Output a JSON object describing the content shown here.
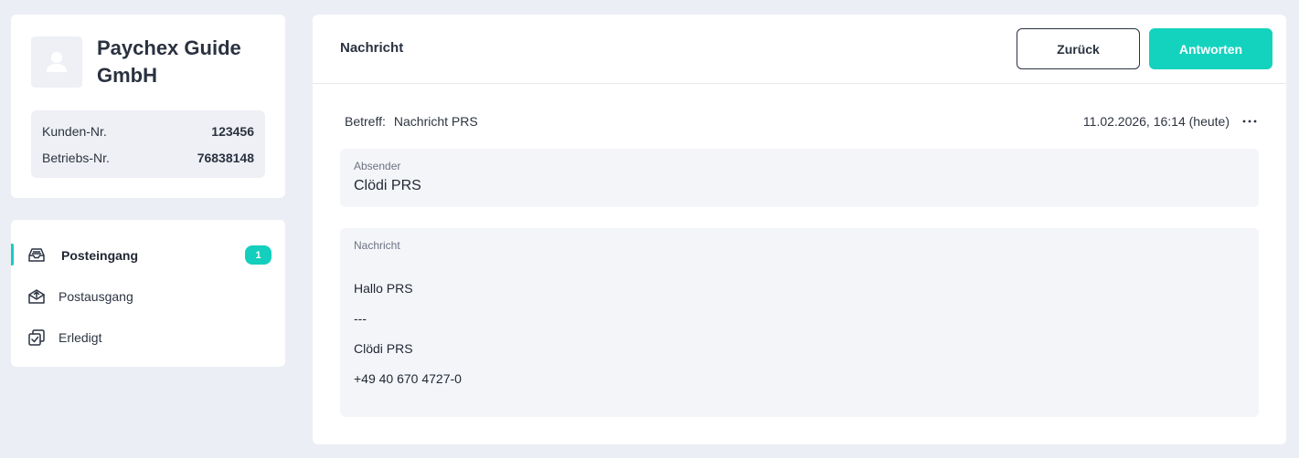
{
  "company": {
    "name": "Paychex Guide GmbH",
    "customer_no_label": "Kunden-Nr.",
    "customer_no": "123456",
    "company_no_label": "Betriebs-Nr.",
    "company_no": "76838148"
  },
  "nav": {
    "items": [
      {
        "label": "Posteingang",
        "icon": "inbox-icon",
        "active": true,
        "badge": "1"
      },
      {
        "label": "Postausgang",
        "icon": "outbox-icon",
        "active": false
      },
      {
        "label": "Erledigt",
        "icon": "done-icon",
        "active": false
      }
    ]
  },
  "header": {
    "title": "Nachricht",
    "back_label": "Zurück",
    "reply_label": "Antworten"
  },
  "message": {
    "subject_label": "Betreff:",
    "subject": "Nachricht PRS",
    "date": "11.02.2026, 16:14 (heute)",
    "sender_label": "Absender",
    "sender": "Clödi PRS",
    "body_label": "Nachricht",
    "body_lines": [
      "Hallo PRS",
      "---",
      "Clödi PRS",
      "+49 40 670 4727-0"
    ]
  },
  "colors": {
    "accent": "#14d3be",
    "background": "#eceef5"
  }
}
